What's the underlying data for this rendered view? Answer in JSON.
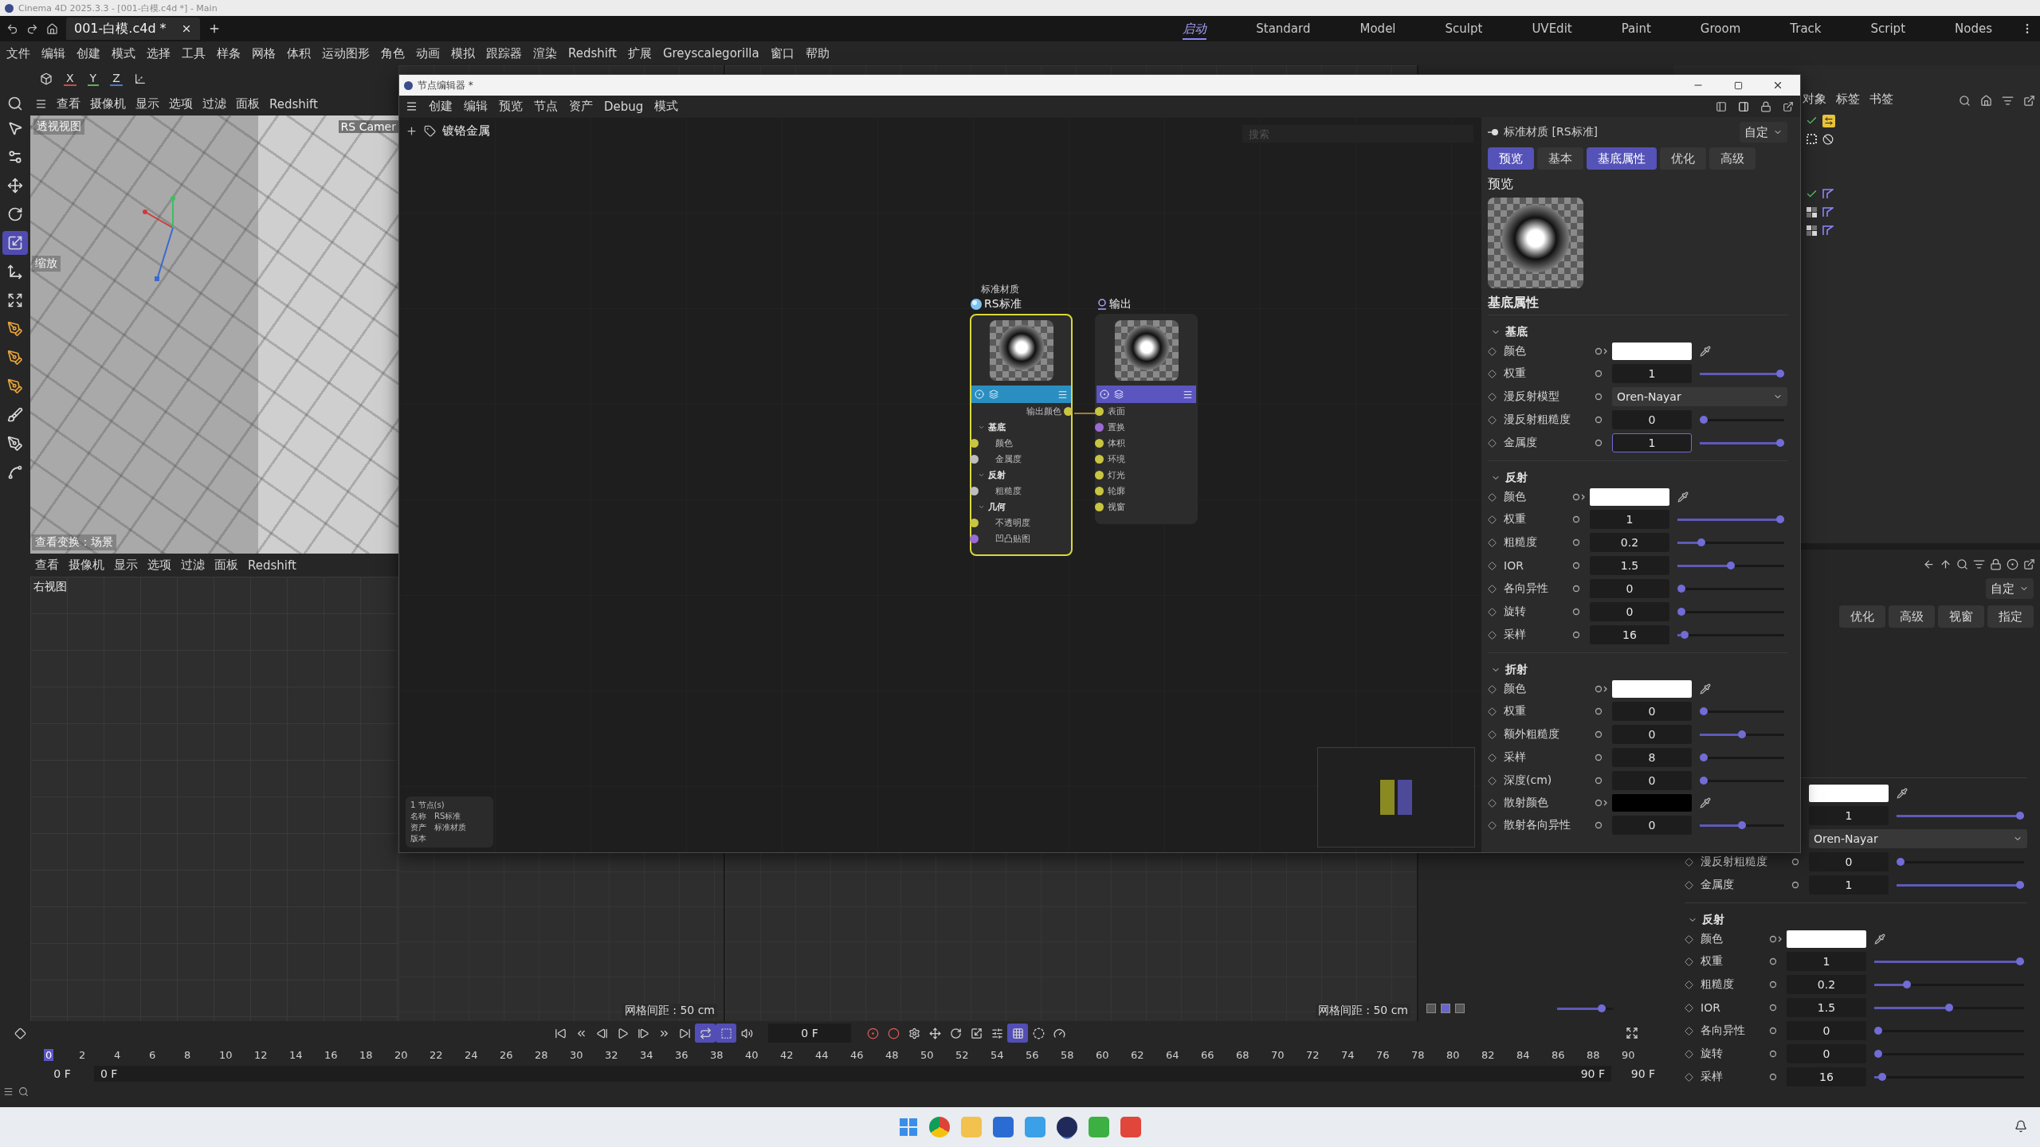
{
  "app_title": "Cinema 4D 2025.3.3 - [001-白模.c4d *] - Main",
  "document_tab": "001-白模.c4d *",
  "layouts": [
    {
      "label": "启动",
      "selected": true
    },
    {
      "label": "Standard",
      "selected": false
    },
    {
      "label": "Model",
      "selected": false
    },
    {
      "label": "Sculpt",
      "selected": false
    },
    {
      "label": "UVEdit",
      "selected": false
    },
    {
      "label": "Paint",
      "selected": false
    },
    {
      "label": "Groom",
      "selected": false
    },
    {
      "label": "Track",
      "selected": false
    },
    {
      "label": "Script",
      "selected": false
    },
    {
      "label": "Nodes",
      "selected": false
    }
  ],
  "menu": [
    "文件",
    "编辑",
    "创建",
    "模式",
    "选择",
    "工具",
    "样条",
    "网格",
    "体积",
    "运动图形",
    "角色",
    "动画",
    "模拟",
    "跟踪器",
    "渲染",
    "Redshift",
    "扩展",
    "Greyscalegorilla",
    "窗口",
    "帮助"
  ],
  "axes": [
    {
      "label": "X",
      "color": "#c84b4b"
    },
    {
      "label": "Y",
      "color": "#58b05a"
    },
    {
      "label": "Z",
      "color": "#4a78d0"
    }
  ],
  "tools": [
    {
      "kind": "select",
      "selected": false
    },
    {
      "kind": "gear",
      "selected": false
    },
    {
      "kind": "move",
      "selected": false
    },
    {
      "kind": "rotate",
      "selected": false
    },
    {
      "kind": "scale",
      "selected": true
    },
    {
      "kind": "axis",
      "selected": false
    },
    {
      "kind": "transform",
      "selected": false
    },
    {
      "kind": "pen",
      "selected": false
    },
    {
      "kind": "pen",
      "selected": false
    },
    {
      "kind": "pen",
      "selected": false
    },
    {
      "kind": "brush",
      "selected": false
    },
    {
      "kind": "pen",
      "selected": false
    },
    {
      "kind": "spline",
      "selected": false
    }
  ],
  "perspective_view": {
    "menu": [
      "查看",
      "摄像机",
      "显示",
      "选项",
      "过滤",
      "面板",
      "Redshift"
    ],
    "title": "透视视图",
    "camera": "RS Camer",
    "tool": "缩放",
    "transform": "查看变换：场景"
  },
  "right_view": {
    "menu": [
      "查看",
      "摄像机",
      "显示",
      "选项",
      "过滤",
      "面板",
      "Redshift"
    ],
    "title": "右视图"
  },
  "grid_views": [
    {
      "grid_spacing": "网格间距 : 50 cm"
    },
    {
      "grid_spacing": "网格间距 : 50 cm"
    }
  ],
  "view_slider": {
    "level": 0.85
  },
  "node_editor": {
    "title": "节点编辑器 *",
    "menu": [
      "创建",
      "编辑",
      "预览",
      "节点",
      "资产",
      "Debug",
      "模式"
    ],
    "breadcrumb": "镀铬金属",
    "search": {
      "placeholder": "搜索"
    },
    "nodes": [
      {
        "kind": "material",
        "caption": "标准材质",
        "title": "RS标准",
        "selected": true,
        "output": "输出颜色",
        "groups": [
          {
            "label": "基底",
            "ports": [
              {
                "label": "颜色",
                "color": "#c9c442"
              },
              {
                "label": "金属度",
                "color": "#bdbdbd"
              }
            ]
          },
          {
            "label": "反射",
            "ports": [
              {
                "label": "粗糙度",
                "color": "#bdbdbd"
              }
            ]
          },
          {
            "label": "几何",
            "ports": [
              {
                "label": "不透明度",
                "color": "#c9c442"
              },
              {
                "label": "凹凸贴图",
                "color": "#9a6ad6"
              }
            ]
          }
        ]
      },
      {
        "kind": "output",
        "title": "输出",
        "selected": false,
        "inputs": [
          {
            "label": "表面",
            "color": "#c9c442"
          },
          {
            "label": "置换",
            "color": "#9a6ad6"
          },
          {
            "label": "体积",
            "color": "#c9c442"
          },
          {
            "label": "环境",
            "color": "#c9c442"
          },
          {
            "label": "灯光",
            "color": "#c9c442"
          },
          {
            "label": "轮廓",
            "color": "#c9c442"
          },
          {
            "label": "视窗",
            "color": "#c9c442"
          }
        ]
      }
    ],
    "info": {
      "count": "1 节点(s)",
      "fields": [
        {
          "key": "名称",
          "value": "RS标准"
        },
        {
          "key": "资产",
          "value": "标准材质"
        },
        {
          "key": "版本"
        }
      ]
    },
    "attributes": {
      "title": "标准材质 [RS标准]",
      "preset": "自定",
      "tabs": [
        {
          "label": "预览",
          "selected": true
        },
        {
          "label": "基本",
          "selected": false
        },
        {
          "label": "基底属性",
          "selected": true
        },
        {
          "label": "优化",
          "selected": false
        },
        {
          "label": "高级",
          "selected": false
        }
      ],
      "preview_label": "预览",
      "heading": "基底属性",
      "sections": [
        {
          "title": "基底",
          "rows": [
            {
              "label": "颜色",
              "kind": "color",
              "color": "#ffffff"
            },
            {
              "label": "权重",
              "kind": "number",
              "value": "1",
              "level": 1
            },
            {
              "label": "漫反射模型",
              "kind": "dropdown",
              "value": "Oren-Nayar"
            },
            {
              "label": "漫反射粗糙度",
              "kind": "number",
              "value": "0",
              "level": 0
            },
            {
              "label": "金属度",
              "kind": "number",
              "value": "1",
              "level": 1,
              "focused": true
            }
          ]
        },
        {
          "title": "反射",
          "rows": [
            {
              "label": "颜色",
              "kind": "color",
              "color": "#ffffff"
            },
            {
              "label": "权重",
              "kind": "number",
              "value": "1",
              "level": 1
            },
            {
              "label": "粗糙度",
              "kind": "number",
              "value": "0.2",
              "level": 0.2
            },
            {
              "label": "IOR",
              "kind": "number",
              "value": "1.5",
              "level": 0.5
            },
            {
              "label": "各向异性",
              "kind": "number",
              "value": "0",
              "level": 0
            },
            {
              "label": "旋转",
              "kind": "number",
              "value": "0",
              "level": 0
            },
            {
              "label": "采样",
              "kind": "number",
              "value": "16",
              "level": 0.03
            }
          ]
        },
        {
          "title": "折射",
          "rows": [
            {
              "label": "颜色",
              "kind": "color",
              "color": "#ffffff"
            },
            {
              "label": "权重",
              "kind": "number",
              "value": "0",
              "level": 0
            },
            {
              "label": "额外粗糙度",
              "kind": "number",
              "value": "0",
              "level": 0.5
            },
            {
              "label": "采样",
              "kind": "number",
              "value": "8",
              "level": 0
            },
            {
              "label": "深度(cm)",
              "kind": "number",
              "value": "0",
              "level": 0
            },
            {
              "label": "散射颜色",
              "kind": "color",
              "color": "#000000"
            },
            {
              "label": "散射各向异性",
              "kind": "number",
              "value": "0",
              "level": 0.5
            }
          ]
        }
      ]
    }
  },
  "object_manager": {
    "tabs": [
      "对象",
      "标签",
      "书签"
    ],
    "rows": [
      {
        "icons": [
          {
            "kind": "check"
          },
          {
            "kind": "swap"
          }
        ]
      },
      {
        "icons": [
          {
            "kind": "dots"
          },
          {
            "kind": "forbidden"
          }
        ]
      },
      {
        "icons": [
          {
            "kind": "check"
          },
          {
            "kind": "material"
          }
        ]
      },
      {
        "icons": [
          {
            "kind": "checker"
          },
          {
            "kind": "material"
          }
        ]
      },
      {
        "icons": [
          {
            "kind": "checker"
          },
          {
            "kind": "material"
          }
        ]
      }
    ]
  },
  "attribute_manager": {
    "preset": "自定",
    "tabs": [
      {
        "label": "优化",
        "selected": false
      },
      {
        "label": "高级",
        "selected": false
      },
      {
        "label": "视窗",
        "selected": false
      },
      {
        "label": "指定",
        "selected": false
      }
    ],
    "sections": [
      {
        "rows": [
          {
            "kind": "color",
            "color": "#ffffff"
          },
          {
            "kind": "number",
            "value": "1",
            "level": 1
          },
          {
            "kind": "dropdown",
            "value": "Oren-Nayar"
          },
          {
            "label": "漫反射粗糙度",
            "kind": "number",
            "value": "0",
            "level": 0
          },
          {
            "label": "金属度",
            "kind": "number",
            "value": "1",
            "level": 1
          }
        ]
      },
      {
        "title": "反射",
        "rows": [
          {
            "label": "颜色",
            "kind": "color",
            "color": "#ffffff"
          },
          {
            "label": "权重",
            "kind": "number",
            "value": "1",
            "level": 1
          },
          {
            "label": "粗糙度",
            "kind": "number",
            "value": "0.2",
            "level": 0.2
          },
          {
            "label": "IOR",
            "kind": "number",
            "value": "1.5",
            "level": 0.5
          },
          {
            "label": "各向异性",
            "kind": "number",
            "value": "0",
            "level": 0
          },
          {
            "label": "旋转",
            "kind": "number",
            "value": "0",
            "level": 0
          },
          {
            "label": "采样",
            "kind": "number",
            "value": "16",
            "level": 0.03
          }
        ]
      }
    ]
  },
  "timeline": {
    "transport": [
      {
        "kind": "first",
        "on": false
      },
      {
        "kind": "prev-key",
        "on": false
      },
      {
        "kind": "prev-frame",
        "on": false
      },
      {
        "kind": "play",
        "on": false
      },
      {
        "kind": "next-frame",
        "on": false
      },
      {
        "kind": "next-key",
        "on": false
      },
      {
        "kind": "last",
        "on": false
      },
      {
        "kind": "loop",
        "on": true
      },
      {
        "kind": "range",
        "on": true
      },
      {
        "kind": "sound",
        "on": false
      }
    ],
    "keying": [
      {
        "kind": "record",
        "on": false
      },
      {
        "kind": "auto",
        "on": false
      },
      {
        "kind": "settings",
        "on": false
      },
      {
        "kind": "move",
        "on": false
      },
      {
        "kind": "rotate",
        "on": false
      },
      {
        "kind": "scale",
        "on": false
      },
      {
        "kind": "param",
        "on": false
      },
      {
        "kind": "grid",
        "on": true
      },
      {
        "kind": "motion",
        "on": false
      },
      {
        "kind": "gauge",
        "on": false
      }
    ],
    "current_frame": "0 F",
    "ticks": [
      "0",
      "2",
      "4",
      "6",
      "8",
      "10",
      "12",
      "14",
      "16",
      "18",
      "20",
      "22",
      "24",
      "26",
      "28",
      "30",
      "32",
      "34",
      "36",
      "38",
      "40",
      "42",
      "44",
      "46",
      "48",
      "50",
      "52",
      "54",
      "56",
      "58",
      "60",
      "62",
      "64",
      "66",
      "68",
      "70",
      "72",
      "74",
      "76",
      "78",
      "80",
      "82",
      "84",
      "86",
      "88",
      "90"
    ],
    "start": "0 F",
    "range_start": "0 F",
    "range_end": "90 F",
    "end": "90 F"
  }
}
